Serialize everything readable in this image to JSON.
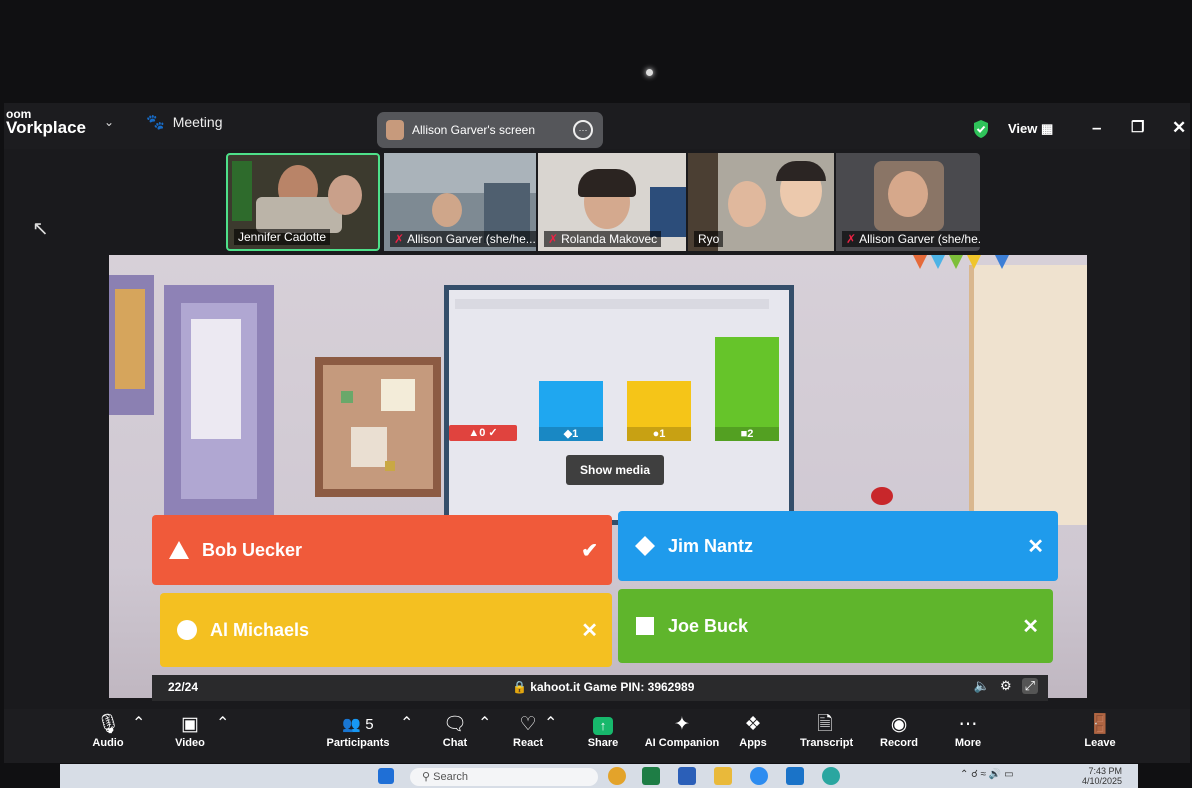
{
  "app": {
    "brand_line1": "oom",
    "brand_line2": "Vorkplace",
    "meeting_label": "Meeting"
  },
  "screen_share": {
    "label": "Allison Garver's screen"
  },
  "top_right": {
    "view_label": "View"
  },
  "participants_strip": [
    {
      "name": "Jennifer Cadotte",
      "muted": false,
      "active": true
    },
    {
      "name": "Allison Garver (she/he...",
      "muted": true
    },
    {
      "name": "Rolanda Makovec",
      "muted": true
    },
    {
      "name": "Ryo",
      "muted": false
    },
    {
      "name": "Allison Garver (she/he...",
      "muted": true
    }
  ],
  "kahoot": {
    "results": [
      {
        "shape": "triangle",
        "count": "0",
        "color": "#e0433e",
        "check": "✓"
      },
      {
        "shape": "diamond",
        "count": "1",
        "color": "#1fa7f0"
      },
      {
        "shape": "circle",
        "count": "1",
        "color": "#f5c518"
      },
      {
        "shape": "square",
        "count": "2",
        "color": "#66c42a"
      }
    ],
    "show_media": "Show media",
    "answers": [
      {
        "text": "Bob Uecker",
        "shape": "triangle",
        "color": "#f05a3a",
        "mark": "✔"
      },
      {
        "text": "Jim Nantz",
        "shape": "diamond",
        "color": "#1f9bec",
        "mark": "✕"
      },
      {
        "text": "Al Michaels",
        "shape": "circle",
        "color": "#f4c021",
        "mark": "✕"
      },
      {
        "text": "Joe Buck",
        "shape": "square",
        "color": "#5fb52c",
        "mark": "✕"
      }
    ],
    "counter": "22/24",
    "pin_text": "kahoot.it  Game PIN: 3962989"
  },
  "toolbar": {
    "audio": "Audio",
    "video": "Video",
    "participants": "Participants",
    "participants_count": "5",
    "chat": "Chat",
    "react": "React",
    "share": "Share",
    "ai_companion": "AI Companion",
    "apps": "Apps",
    "transcript": "Transcript",
    "record": "Record",
    "more": "More",
    "leave": "Leave"
  },
  "taskbar": {
    "search_placeholder": "Search",
    "time": "7:43 PM",
    "date": "4/10/2025"
  },
  "colors": {
    "zoom_bg": "#1a1a1d",
    "active_border": "#4ee08a",
    "share_green": "#17b86c"
  }
}
